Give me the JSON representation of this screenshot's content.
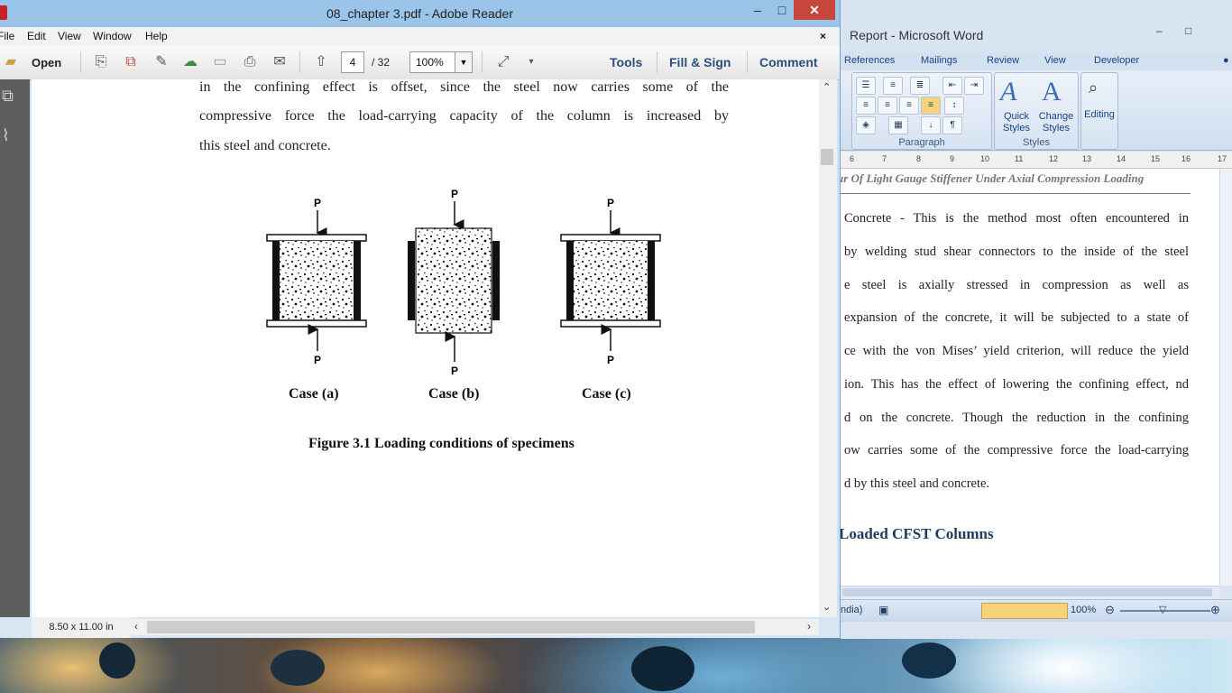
{
  "adobe": {
    "title": "08_chapter 3.pdf - Adobe Reader",
    "window_controls": {
      "minimize": "–",
      "maximize": "□",
      "close": "✕"
    },
    "menu": [
      "File",
      "Edit",
      "View",
      "Window",
      "Help"
    ],
    "menu_close": "×",
    "toolbar": {
      "open_label": "Open",
      "page_current": "4",
      "page_total": "/ 32",
      "zoom_value": "100%",
      "tools_label": "Tools",
      "fill_sign_label": "Fill & Sign",
      "comment_label": "Comment"
    },
    "document": {
      "paragraph_lines": [
        "in the confining effect is offset, since the steel now carries some of the",
        "compressive force the load-carrying capacity of the column is increased by",
        "this steel and concrete."
      ],
      "figure": {
        "load_label": "P",
        "cases": [
          "Case (a)",
          "Case (b)",
          "Case (c)"
        ],
        "caption": "Figure 3.1 Loading conditions of specimens"
      }
    },
    "status": {
      "page_size": "8.50 x 11.00 in"
    }
  },
  "word": {
    "title": "Report - Microsoft Word",
    "window_controls": {
      "minimize": "–",
      "maximize": "□"
    },
    "ribbon_tabs": [
      "References",
      "Mailings",
      "Review",
      "View",
      "Developer"
    ],
    "ribbon": {
      "paragraph_group": "Paragraph",
      "styles_group": "Styles",
      "quick_styles": "Quick Styles",
      "change_styles": "Change Styles",
      "editing": "Editing"
    },
    "ruler_marks": [
      "6",
      "7",
      "8",
      "9",
      "10",
      "11",
      "12",
      "13",
      "14",
      "15",
      "16",
      "17"
    ],
    "document": {
      "header": "ur Of Light Gauge Stiffener Under Axial Compression Loading",
      "lines": [
        "Concrete - This is the method most often encountered in",
        "by welding stud shear connectors to the inside of the steel",
        "e steel is axially stressed in compression as well as",
        "expansion of the concrete, it will be subjected to a state of",
        "ce with the von Mises’ yield criterion, will reduce the yield",
        "ion. This has the effect of lowering the confining effect, nd",
        "d on the concrete. Though the reduction in the confining",
        "ow carries some of the compressive force the load-carrying",
        "d by this steel and concrete."
      ],
      "heading": "Loaded CFST Columns"
    },
    "status": {
      "language": "ndia)",
      "zoom": "100%"
    }
  }
}
